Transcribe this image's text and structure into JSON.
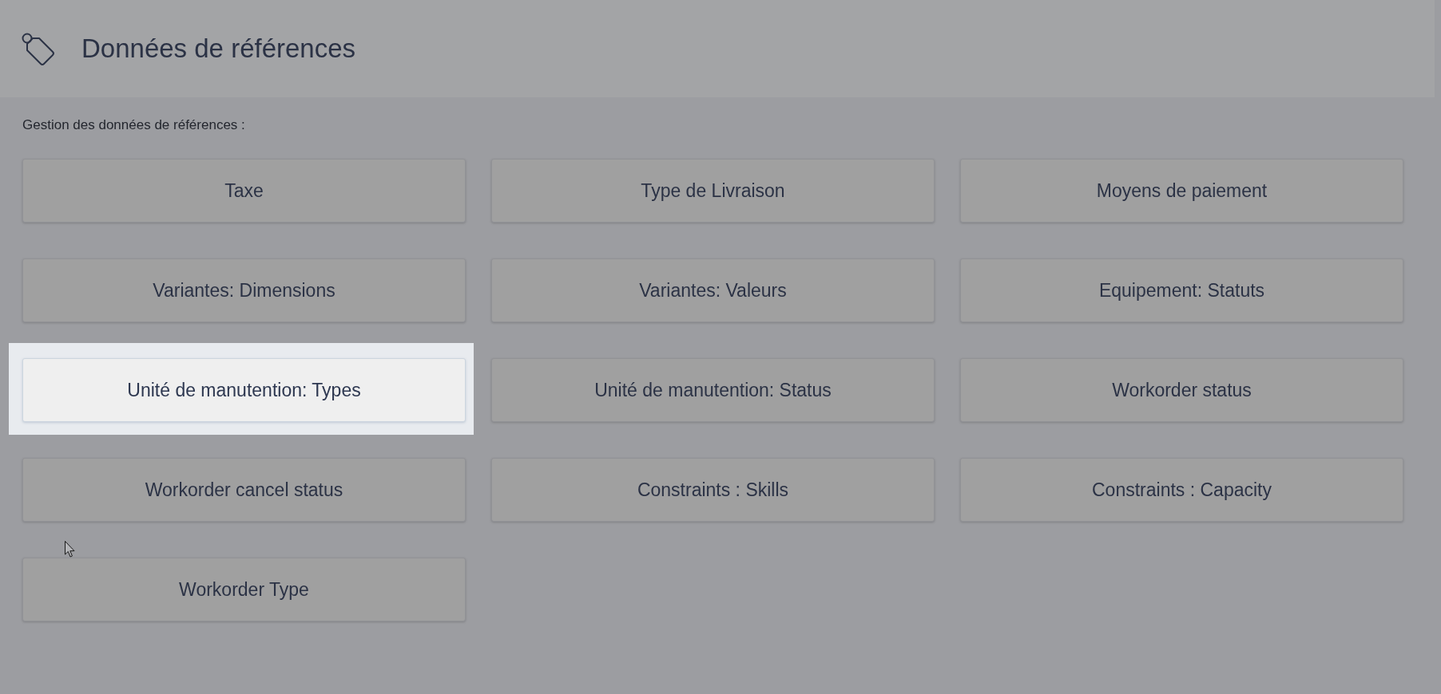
{
  "header": {
    "title": "Données de références"
  },
  "intro": "Gestion des données de références :",
  "buttons": [
    {
      "label": "Taxe",
      "highlighted": false
    },
    {
      "label": "Type de Livraison",
      "highlighted": false
    },
    {
      "label": "Moyens de paiement",
      "highlighted": false
    },
    {
      "label": "Variantes: Dimensions",
      "highlighted": false
    },
    {
      "label": "Variantes: Valeurs",
      "highlighted": false
    },
    {
      "label": "Equipement: Statuts",
      "highlighted": false
    },
    {
      "label": "Unité de manutention: Types",
      "highlighted": true
    },
    {
      "label": "Unité de manutention: Status",
      "highlighted": false
    },
    {
      "label": "Workorder status",
      "highlighted": false
    },
    {
      "label": "Workorder cancel status",
      "highlighted": false
    },
    {
      "label": "Constraints : Skills",
      "highlighted": false
    },
    {
      "label": "Constraints : Capacity",
      "highlighted": false
    },
    {
      "label": "Workorder Type",
      "highlighted": false
    }
  ]
}
